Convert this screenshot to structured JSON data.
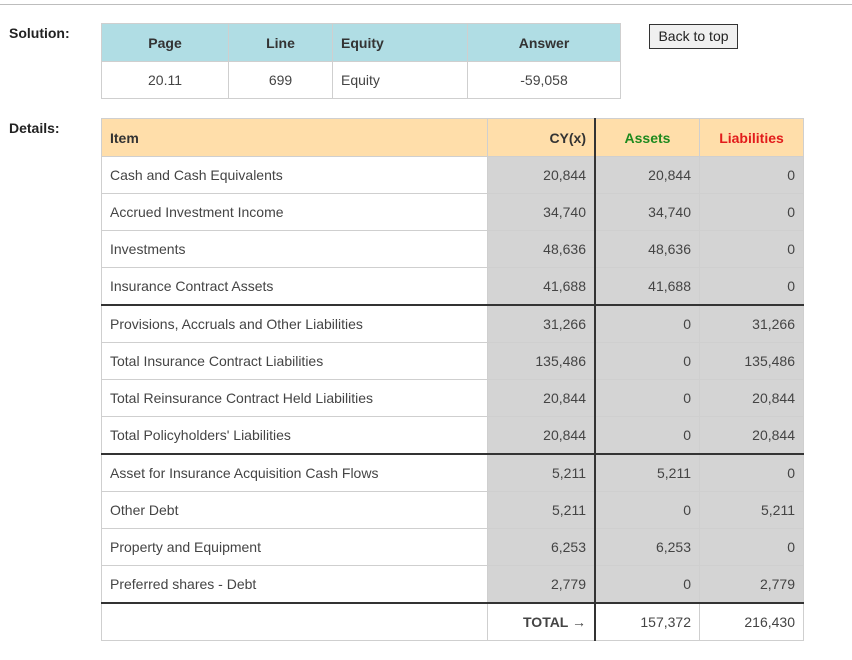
{
  "solution": {
    "label": "Solution:",
    "headers": {
      "page": "Page",
      "line": "Line",
      "equity": "Equity",
      "answer": "Answer"
    },
    "row": {
      "page": "20.11",
      "line": "699",
      "equity": "Equity",
      "answer": "-59,058"
    }
  },
  "back_to_top": "Back to top",
  "details": {
    "label": "Details:",
    "headers": {
      "item": "Item",
      "cy": "CY(x)",
      "assets": "Assets",
      "liabilities": "Liabilities"
    },
    "header_colors": {
      "assets": "#1e8a1e",
      "liabilities": "#e21b1b"
    },
    "rows": [
      {
        "item": "Cash and Cash Equivalents",
        "cy": "20,844",
        "assets": "20,844",
        "liabilities": "0"
      },
      {
        "item": "Accrued Investment Income",
        "cy": "34,740",
        "assets": "34,740",
        "liabilities": "0"
      },
      {
        "item": "Investments",
        "cy": "48,636",
        "assets": "48,636",
        "liabilities": "0"
      },
      {
        "item": "Insurance Contract Assets",
        "cy": "41,688",
        "assets": "41,688",
        "liabilities": "0"
      },
      {
        "item": "Provisions, Accruals and Other Liabilities",
        "cy": "31,266",
        "assets": "0",
        "liabilities": "31,266"
      },
      {
        "item": "Total Insurance Contract Liabilities",
        "cy": "135,486",
        "assets": "0",
        "liabilities": "135,486"
      },
      {
        "item": "Total Reinsurance Contract Held Liabilities",
        "cy": "20,844",
        "assets": "0",
        "liabilities": "20,844"
      },
      {
        "item": "Total Policyholders' Liabilities",
        "cy": "20,844",
        "assets": "0",
        "liabilities": "20,844"
      },
      {
        "item": "Asset for Insurance Acquisition Cash Flows",
        "cy": "5,211",
        "assets": "5,211",
        "liabilities": "0"
      },
      {
        "item": "Other Debt",
        "cy": "5,211",
        "assets": "0",
        "liabilities": "5,211"
      },
      {
        "item": "Property and Equipment",
        "cy": "6,253",
        "assets": "6,253",
        "liabilities": "0"
      },
      {
        "item": "Preferred shares - Debt",
        "cy": "2,779",
        "assets": "0",
        "liabilities": "2,779"
      }
    ],
    "total": {
      "label": "TOTAL →",
      "assets": "157,372",
      "liabilities": "216,430"
    }
  }
}
